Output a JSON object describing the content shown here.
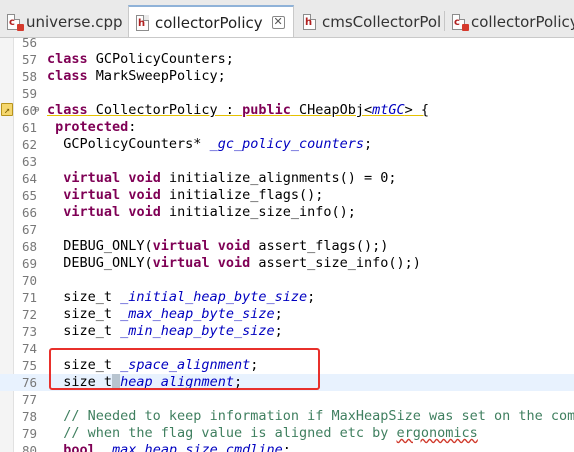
{
  "tabs": [
    {
      "label": "universe.cpp",
      "active": false,
      "icon": "cpp-file-icon"
    },
    {
      "label": "collectorPolicy",
      "active": true,
      "icon": "header-file-icon",
      "close": "✕"
    },
    {
      "label": "cmsCollectorPol",
      "active": false,
      "icon": "header-file-icon"
    },
    {
      "label": "collectorPolicy",
      "active": false,
      "icon": "cpp-file-icon"
    }
  ],
  "editor": {
    "current_line": 76,
    "highlight_lines": [
      75,
      76
    ],
    "lines": [
      {
        "n": "56",
        "text": ""
      },
      {
        "n": "57",
        "text": "class GCPolicyCounters;"
      },
      {
        "n": "58",
        "text": "class MarkSweepPolicy;"
      },
      {
        "n": "59",
        "text": ""
      },
      {
        "n": "60",
        "text": "class CollectorPolicy : public CHeapObj<mtGC> {"
      },
      {
        "n": "61",
        "text": " protected:"
      },
      {
        "n": "62",
        "text": "  GCPolicyCounters* _gc_policy_counters;"
      },
      {
        "n": "63",
        "text": ""
      },
      {
        "n": "64",
        "text": "  virtual void initialize_alignments() = 0;"
      },
      {
        "n": "65",
        "text": "  virtual void initialize_flags();"
      },
      {
        "n": "66",
        "text": "  virtual void initialize_size_info();"
      },
      {
        "n": "67",
        "text": ""
      },
      {
        "n": "68",
        "text": "  DEBUG_ONLY(virtual void assert_flags();)"
      },
      {
        "n": "69",
        "text": "  DEBUG_ONLY(virtual void assert_size_info();)"
      },
      {
        "n": "70",
        "text": ""
      },
      {
        "n": "71",
        "text": "  size_t _initial_heap_byte_size;"
      },
      {
        "n": "72",
        "text": "  size_t _max_heap_byte_size;"
      },
      {
        "n": "73",
        "text": "  size_t _min_heap_byte_size;"
      },
      {
        "n": "74",
        "text": ""
      },
      {
        "n": "75",
        "text": "  size_t _space_alignment;"
      },
      {
        "n": "76",
        "text": "  size_t _heap_alignment;"
      },
      {
        "n": "77",
        "text": ""
      },
      {
        "n": "78",
        "text": "  // Needed to keep information if MaxHeapSize was set on the comm"
      },
      {
        "n": "79",
        "text": "  // when the flag value is aligned etc by ergonomics"
      },
      {
        "n": "80",
        "text": "  bool _max_heap_size_cmdline;"
      }
    ]
  },
  "colors": {
    "keyword": "#7f0055",
    "field": "#0000c0",
    "comment": "#3f7f5f",
    "highlight_box": "#e8302b",
    "current_line": "#e8f2fe"
  }
}
